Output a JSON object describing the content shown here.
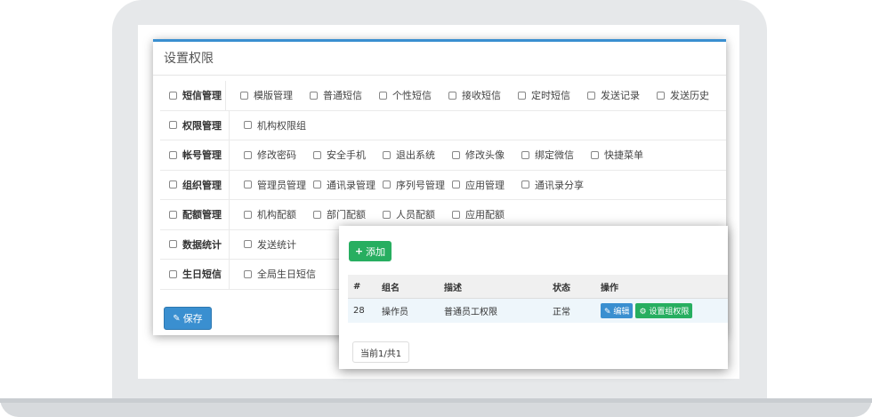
{
  "perm_panel": {
    "title": "设置权限",
    "save_label": "保存",
    "rows": [
      {
        "category": "短信管理",
        "items": [
          "模版管理",
          "普通短信",
          "个性短信",
          "接收短信",
          "定时短信",
          "发送记录",
          "发送历史"
        ]
      },
      {
        "category": "权限管理",
        "items": [
          "机构权限组"
        ]
      },
      {
        "category": "帐号管理",
        "items": [
          "修改密码",
          "安全手机",
          "退出系统",
          "修改头像",
          "绑定微信",
          "快捷菜单"
        ]
      },
      {
        "category": "组织管理",
        "items": [
          "管理员管理",
          "通讯录管理",
          "序列号管理",
          "应用管理",
          "通讯录分享"
        ]
      },
      {
        "category": "配额管理",
        "items": [
          "机构配额",
          "部门配额",
          "人员配额",
          "应用配额"
        ]
      },
      {
        "category": "数据统计",
        "items": [
          "发送统计"
        ]
      },
      {
        "category": "生日短信",
        "items": [
          "全局生日短信"
        ]
      }
    ]
  },
  "group_panel": {
    "add_label": "添加",
    "headers": [
      "#",
      "组名",
      "描述",
      "状态",
      "操作"
    ],
    "rows": [
      {
        "id": "28",
        "name": "操作员",
        "desc": "普通员工权限",
        "status": "正常",
        "edit_label": "编辑",
        "set_label": "设置组权限"
      }
    ],
    "pager_label": "当前1/共1"
  },
  "colors": {
    "primary": "#3a8fd0",
    "success": "#27ae60"
  }
}
